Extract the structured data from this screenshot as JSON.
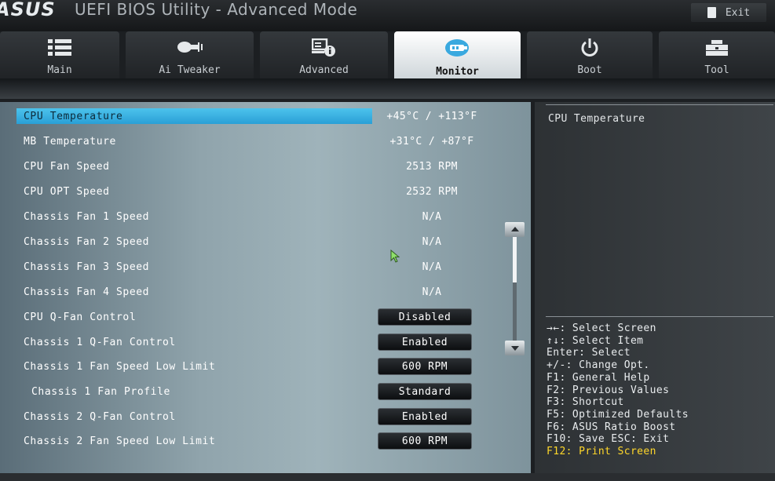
{
  "header": {
    "logo": "ASUS",
    "title": "UEFI BIOS Utility - Advanced Mode",
    "exit_label": "Exit"
  },
  "tabs": [
    {
      "label": "Main",
      "icon": "list-icon"
    },
    {
      "label": "Ai Tweaker",
      "icon": "tweaker-icon"
    },
    {
      "label": "Advanced",
      "icon": "advanced-icon"
    },
    {
      "label": "Monitor",
      "icon": "monitor-icon",
      "active": true
    },
    {
      "label": "Boot",
      "icon": "power-icon"
    },
    {
      "label": "Tool",
      "icon": "tool-icon"
    }
  ],
  "rows": [
    {
      "label": "CPU Temperature",
      "value": "+45°C / +113°F"
    },
    {
      "label": "MB Temperature",
      "value": "+31°C / +87°F"
    },
    {
      "label": "CPU Fan Speed",
      "value": "2513 RPM"
    },
    {
      "label": "CPU OPT Speed",
      "value": "2532 RPM"
    },
    {
      "label": "Chassis Fan 1 Speed",
      "value": "N/A"
    },
    {
      "label": "Chassis Fan 2 Speed",
      "value": "N/A"
    },
    {
      "label": "Chassis Fan 3 Speed",
      "value": "N/A"
    },
    {
      "label": "Chassis Fan 4 Speed",
      "value": "N/A"
    },
    {
      "label": "CPU Q-Fan Control",
      "value": "Disabled"
    },
    {
      "label": "Chassis 1 Q-Fan Control",
      "value": "Enabled"
    },
    {
      "label": "Chassis 1 Fan Speed Low Limit",
      "value": "600 RPM"
    },
    {
      "label": "Chassis 1 Fan Profile",
      "value": "Standard"
    },
    {
      "label": "Chassis 2 Q-Fan Control",
      "value": "Enabled"
    },
    {
      "label": "Chassis 2 Fan Speed Low Limit",
      "value": "600 RPM"
    }
  ],
  "help": {
    "description": "CPU Temperature",
    "keys": [
      "→←: Select Screen",
      "↑↓: Select Item",
      "Enter: Select",
      "+/-: Change Opt.",
      "F1: General Help",
      "F2: Previous Values",
      "F3: Shortcut",
      "F5: Optimized Defaults",
      "F6: ASUS Ratio Boost",
      "F10: Save  ESC: Exit",
      "F12: Print Screen"
    ]
  },
  "colors": {
    "highlight": "#3bb3e6",
    "hotkey": "#ffd72a"
  }
}
